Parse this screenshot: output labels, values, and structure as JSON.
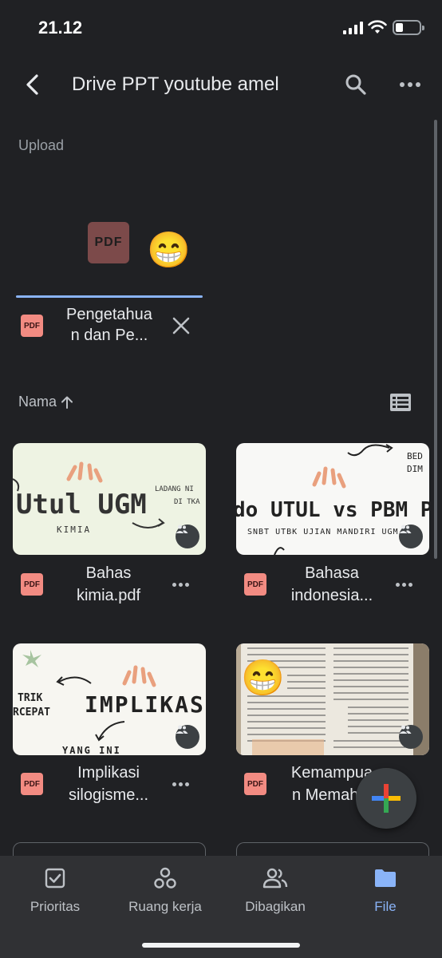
{
  "status_bar": {
    "time": "21.12"
  },
  "header": {
    "title": "Drive PPT youtube amel"
  },
  "upload": {
    "section_label": "Upload",
    "preview_icon_text": "PDF",
    "file_type_label": "PDF",
    "file_name_line1": "Pengetahua",
    "file_name_line2": "n dan Pe..."
  },
  "sort": {
    "label": "Nama"
  },
  "files": [
    {
      "type_label": "PDF",
      "name_line1": "Bahas",
      "name_line2": "kimia.pdf",
      "thumb_title": "Utul UGM",
      "thumb_sub": "KIMIA",
      "thumb_side": "LADANG NI",
      "thumb_side2": "DI TKA"
    },
    {
      "type_label": "PDF",
      "name_line1": "Bahasa",
      "name_line2": "indonesia...",
      "thumb_title": "do UTUL vs PBM PPU",
      "thumb_sub": "SNBT UTBK UJIAN MANDIRI UGM IT",
      "thumb_side": "BED",
      "thumb_side2": "DIM"
    },
    {
      "type_label": "PDF",
      "name_line1": "Implikasi",
      "name_line2": "silogisme...",
      "thumb_title": "IMPLIKASI",
      "thumb_sub": "YANG INI",
      "thumb_side": "TRIK",
      "thumb_side2": "RCEPAT"
    },
    {
      "type_label": "PDF",
      "name_line1": "Kemampua",
      "name_line2": "n Memah..."
    }
  ],
  "bottom_nav": [
    {
      "label": "Prioritas"
    },
    {
      "label": "Ruang kerja"
    },
    {
      "label": "Dibagikan"
    },
    {
      "label": "File",
      "active": true
    }
  ],
  "colors": {
    "accent": "#8ab4f8",
    "background": "#202124",
    "pdf_red": "#f28b82"
  }
}
